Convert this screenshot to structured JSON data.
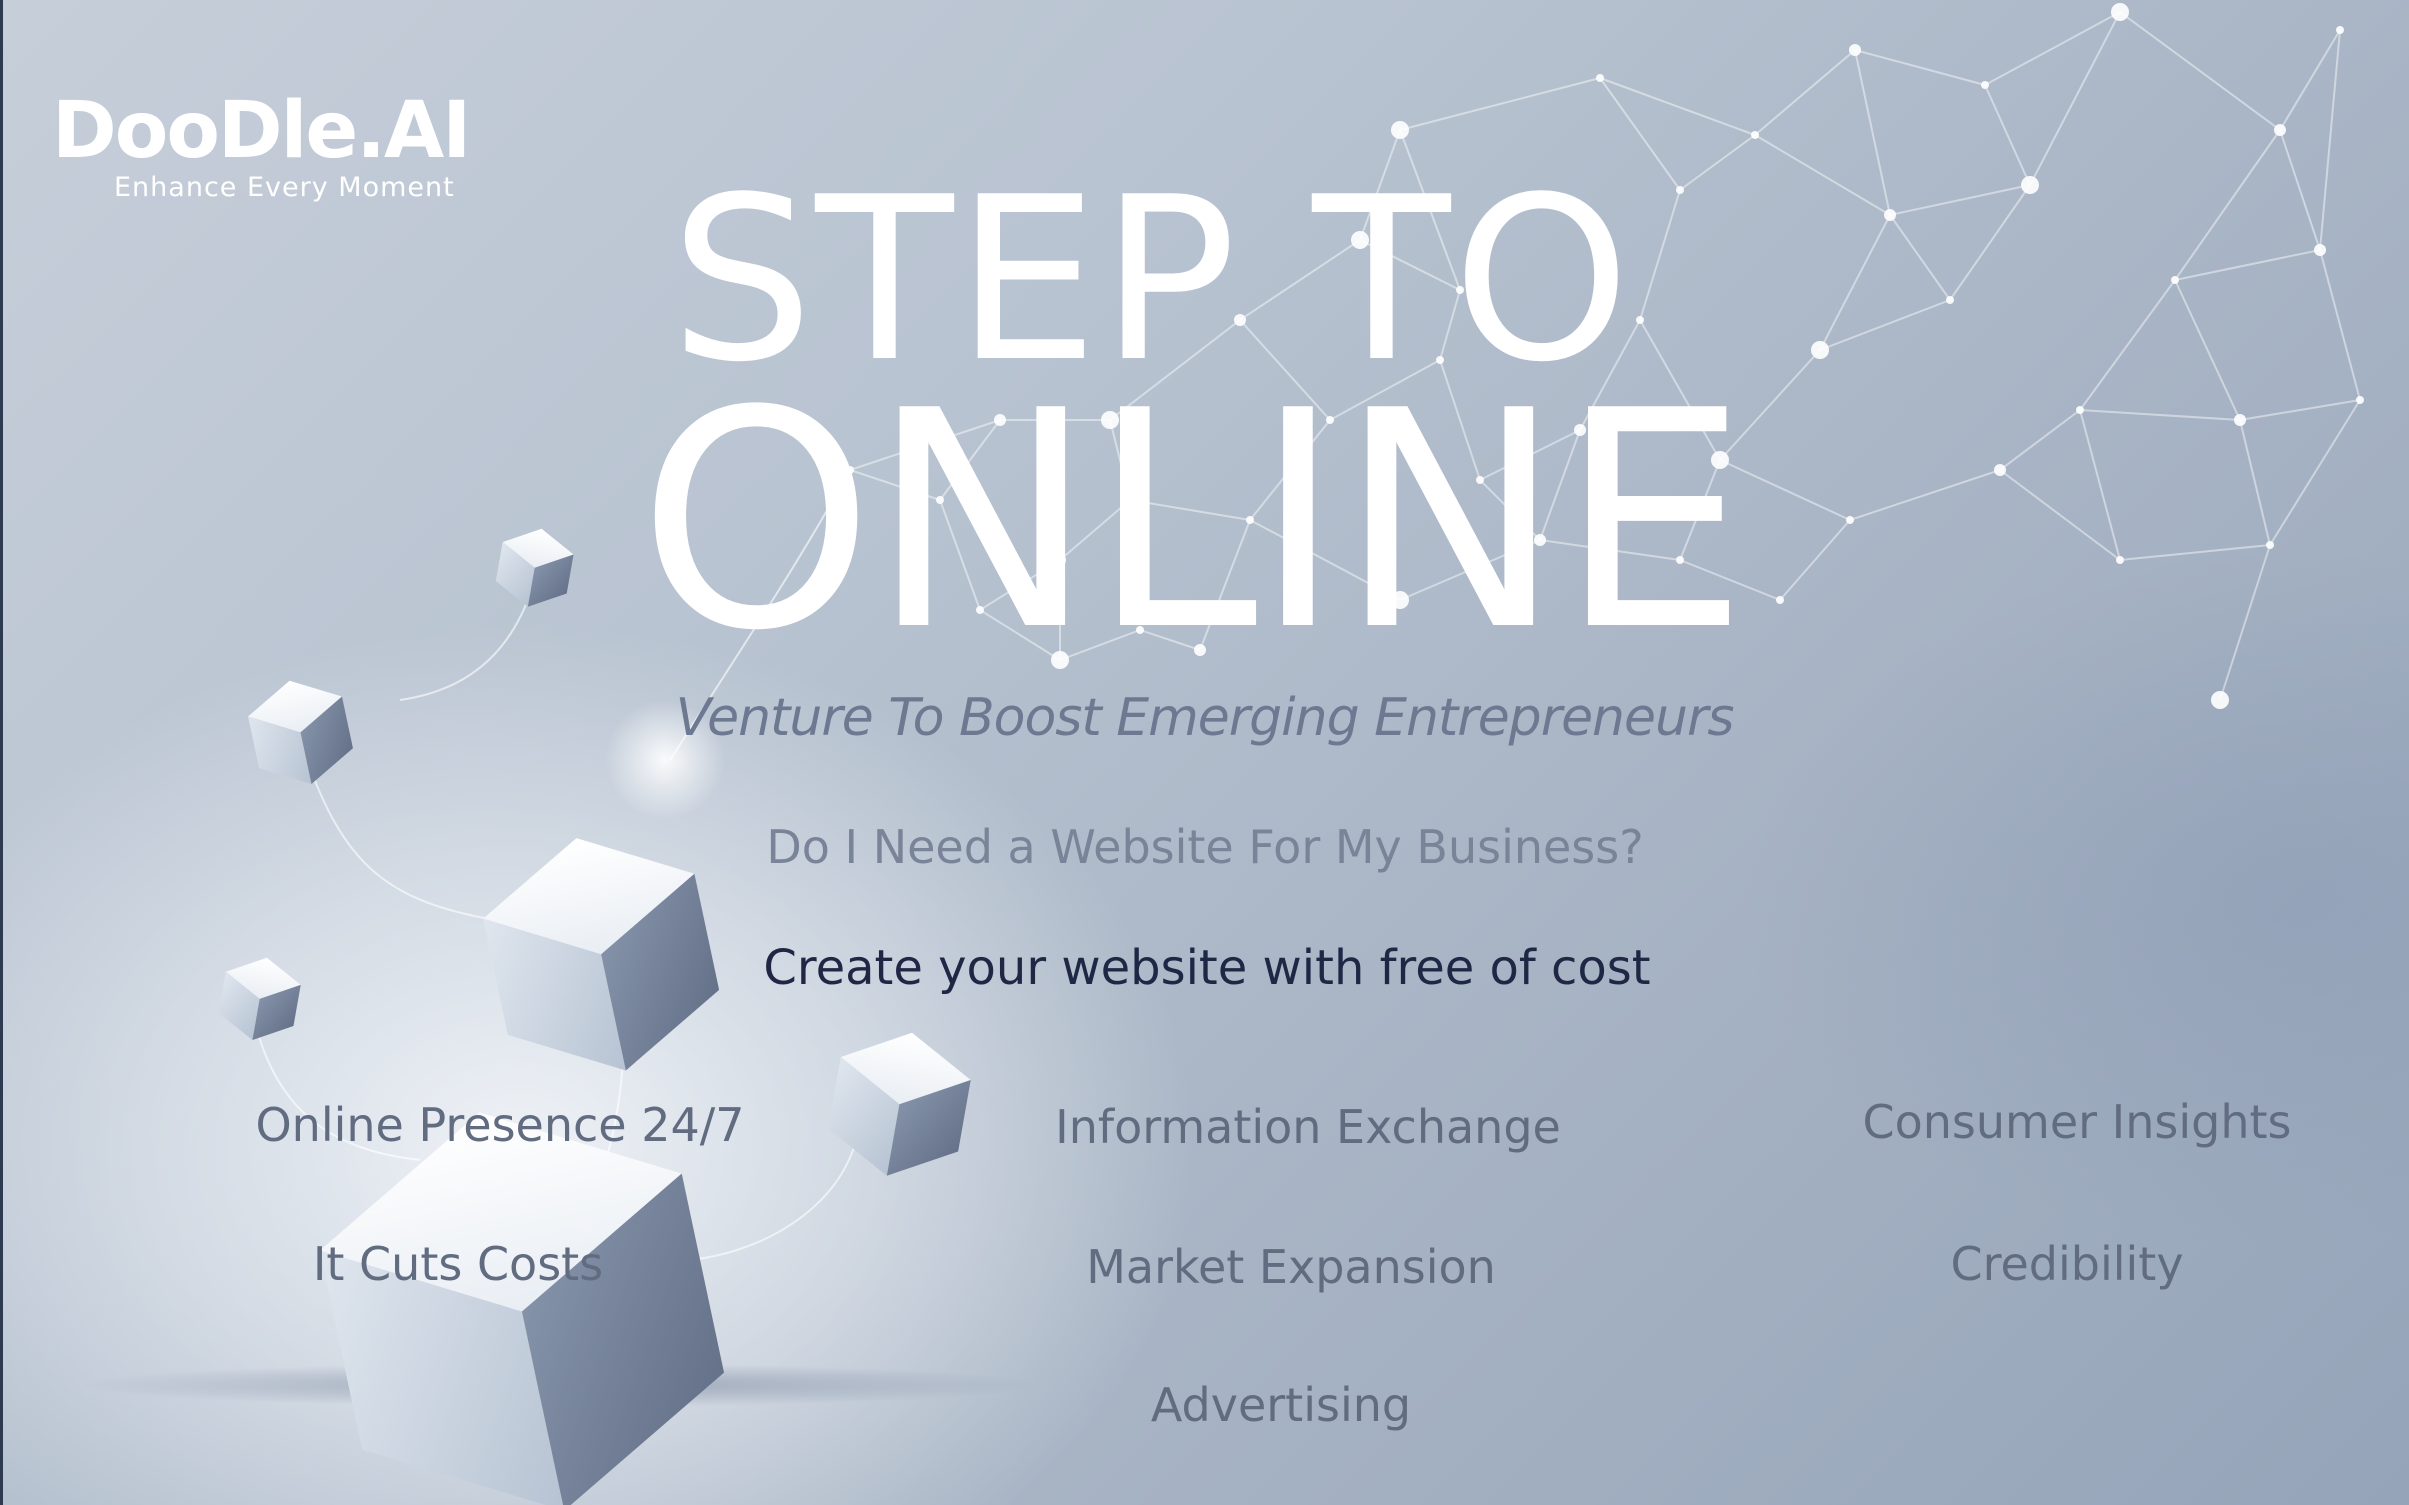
{
  "brand": {
    "name": "DooDle.AI",
    "tagline": "Enhance Every Moment"
  },
  "hero": {
    "line1": "STEP TO",
    "line2": "ONLINE",
    "subtitle": "Venture To Boost Emerging Entrepreneurs",
    "question": "Do I Need a Website For My Business?",
    "cta": "Create your website with free of cost"
  },
  "benefits": [
    "Online Presence 24/7",
    "Information Exchange",
    "Consumer Insights",
    "It Cuts Costs",
    "Market Expansion",
    "Credibility",
    "Advertising"
  ],
  "colors": {
    "background": "#b8c3d1",
    "headline": "#ffffff",
    "subtitle": "#6d7891",
    "cta": "#1f2745",
    "benefit_text": "#626c80"
  }
}
